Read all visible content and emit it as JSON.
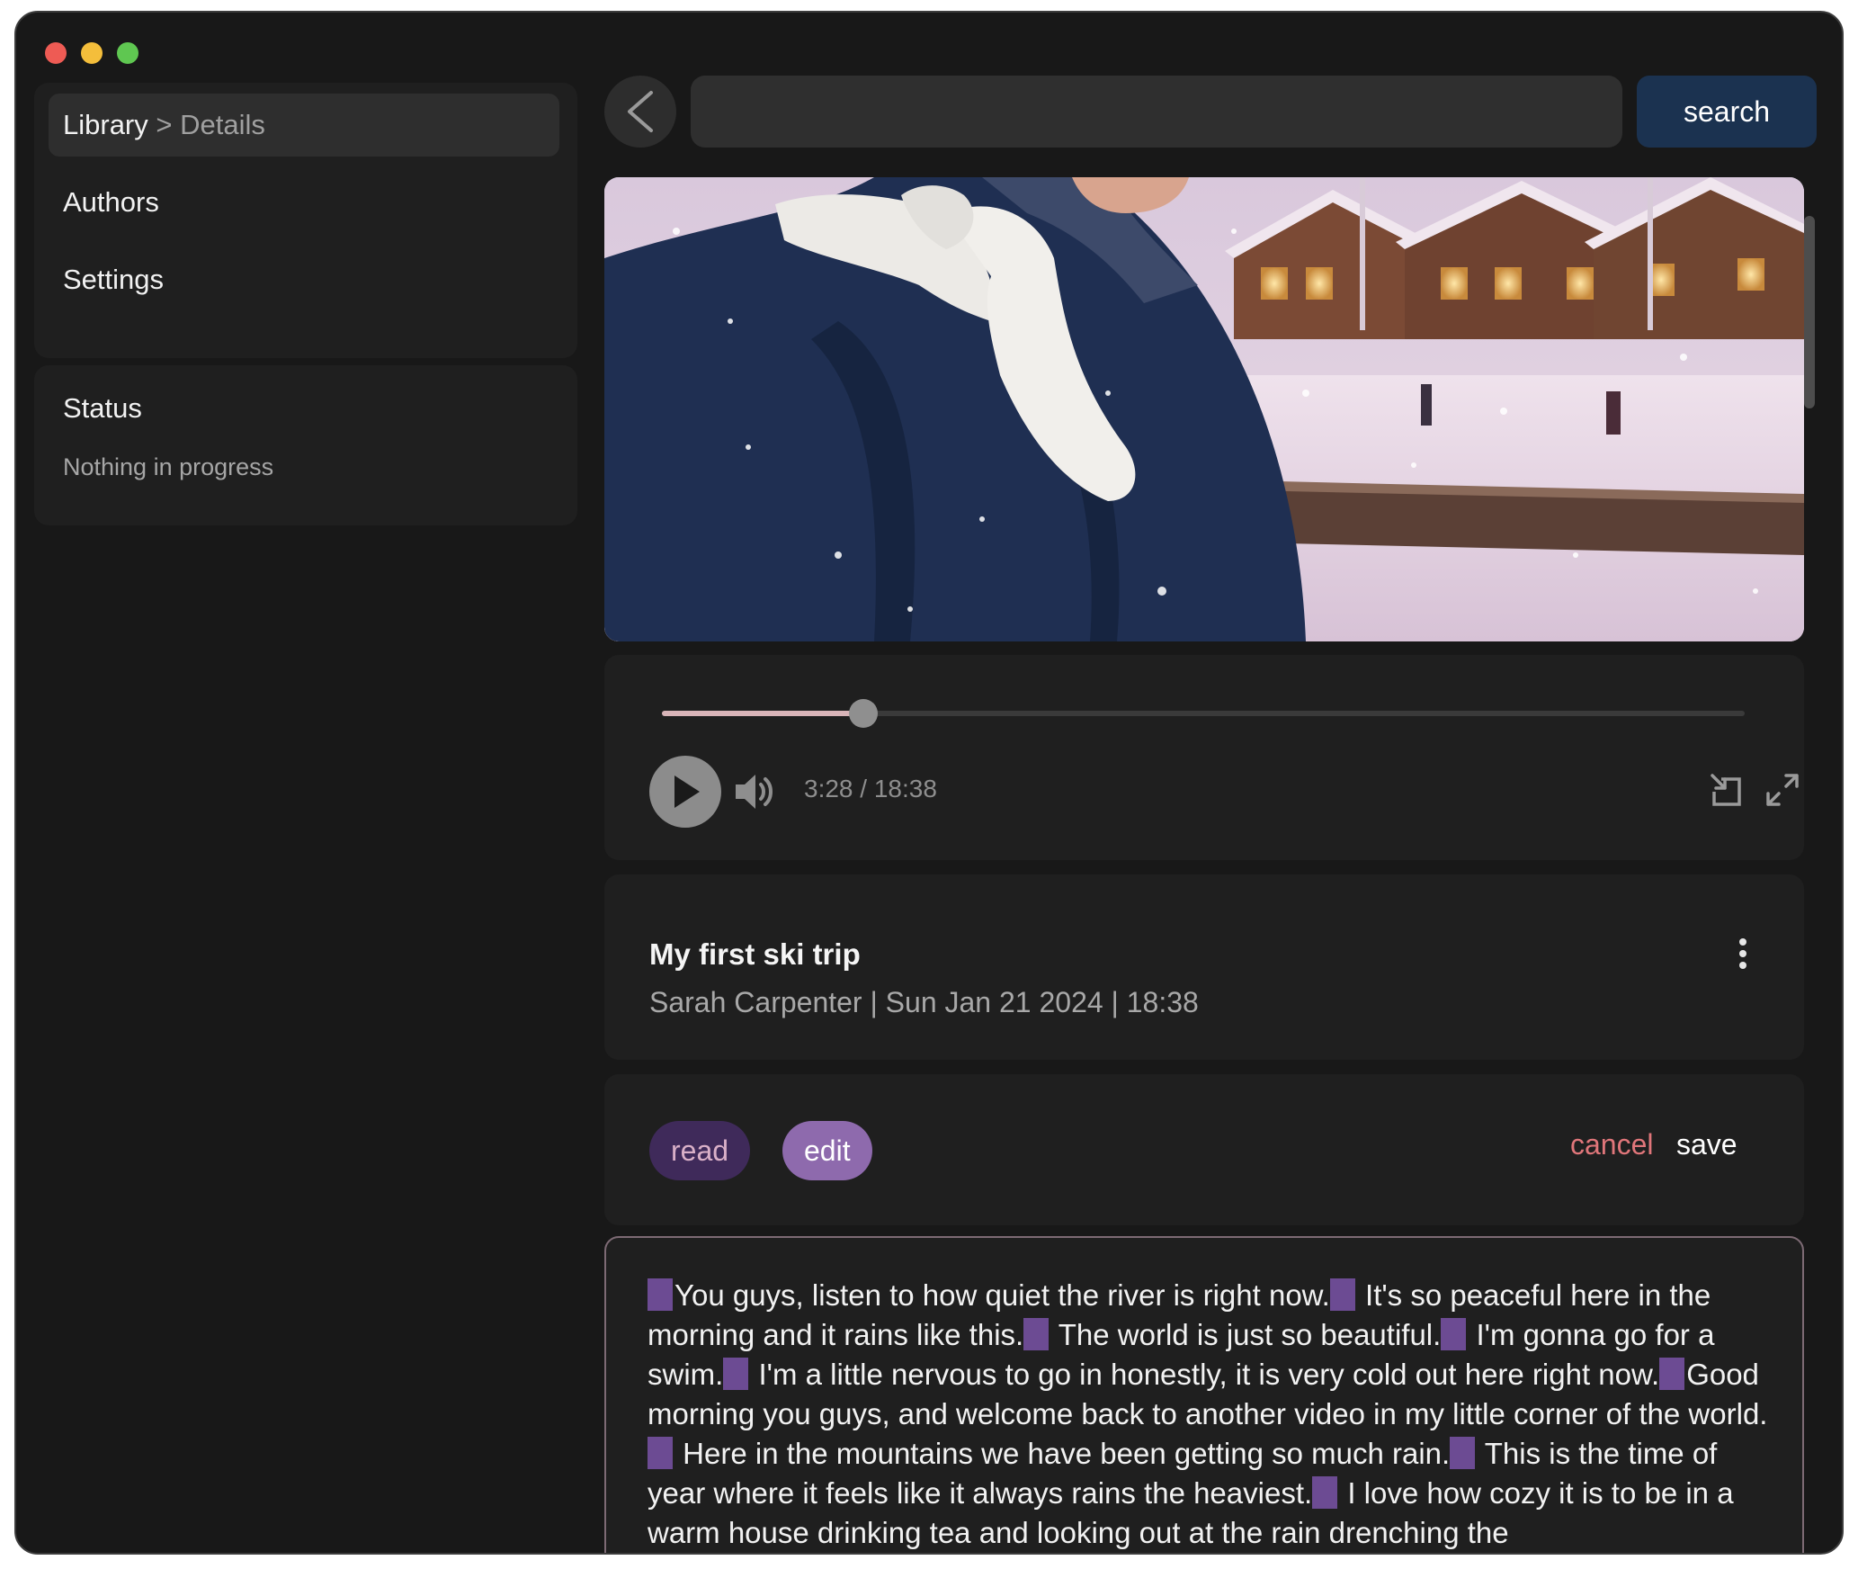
{
  "window": {
    "traffic_lights": [
      "close",
      "minimize",
      "maximize"
    ]
  },
  "sidebar": {
    "breadcrumb": {
      "root": "Library",
      "separator": ">",
      "current": "Details"
    },
    "items": [
      {
        "label": "Authors"
      },
      {
        "label": "Settings"
      }
    ],
    "status": {
      "title": "Status",
      "text": "Nothing in progress"
    }
  },
  "topbar": {
    "back_icon": "chevron-left-icon",
    "search_placeholder": "",
    "search_value": "",
    "search_label": "search"
  },
  "video": {
    "thumbnail": "woman-in-snow-making-heart-with-mittens"
  },
  "player": {
    "progress_fraction": 0.1857,
    "time_text": "3:28 / 18:38",
    "icons": [
      "play-icon",
      "volume-icon",
      "picture-in-picture-icon",
      "fullscreen-icon"
    ]
  },
  "info": {
    "title": "My first ski trip",
    "meta": "Sarah Carpenter | Sun Jan 21 2024 | 18:38",
    "menu_icon": "more-vertical-icon"
  },
  "modes": {
    "read": "read",
    "edit": "edit",
    "cancel": "cancel",
    "save": "save"
  },
  "transcript": {
    "segments": [
      "You guys, listen to how quiet the river is right now.",
      " It's so peaceful here in the morning and it rains like this.",
      " The world is just so beautiful.",
      " I'm gonna go for a swim.",
      " I'm a little nervous to go in honestly, it is very cold out here right now.",
      "Good morning you guys, and welcome back to another video in my little corner of the world.",
      " Here in the mountains we have been getting so much rain.",
      " This is the time of year where it feels like it always rains the heaviest.",
      " I love how cozy it is to be in a warm house drinking tea and looking out at the rain drenching the"
    ]
  },
  "colors": {
    "window_bg": "#181818",
    "panel_bg": "#1f1f1f",
    "search_button": "#1b3250",
    "read_pill": "#3f2a5a",
    "edit_pill": "#8e6aad",
    "cancel_text": "#e0767a",
    "segment_marker": "#6c4b93",
    "progress_fill": "#d8b4b8"
  }
}
